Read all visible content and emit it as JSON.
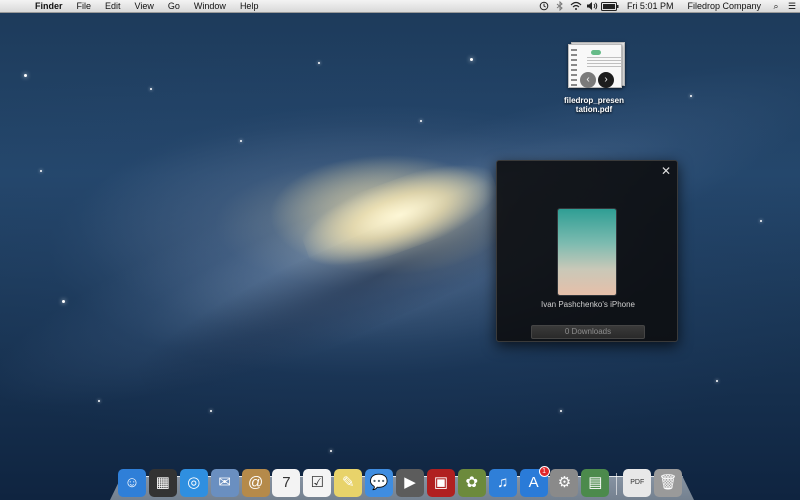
{
  "menubar": {
    "apple_glyph": "",
    "app_name": "Finder",
    "menus": [
      "File",
      "Edit",
      "View",
      "Go",
      "Window",
      "Help"
    ],
    "status_icons": [
      "time-machine-icon",
      "bluetooth-icon",
      "wifi-icon",
      "volume-icon",
      "battery-icon"
    ],
    "clock": "Fri 5:01 PM",
    "user": "Filedrop Company",
    "search_glyph": "⌕",
    "notifications_glyph": "☰"
  },
  "desktop_file": {
    "name": "filedrop_presentation.pdf",
    "label_line1": "filedrop_presen",
    "label_line2": "tation.pdf"
  },
  "popup": {
    "close_glyph": "✕",
    "device_name": "Ivan Pashchenko's iPhone",
    "downloads_label": "0 Downloads"
  },
  "dock": {
    "items": [
      {
        "name": "finder",
        "glyph": "☺",
        "color": "#2f7fd8"
      },
      {
        "name": "launchpad",
        "glyph": "▦",
        "color": "#333333"
      },
      {
        "name": "safari",
        "glyph": "◎",
        "color": "#2f8fe0"
      },
      {
        "name": "mail",
        "glyph": "✉",
        "color": "#6a8fc0"
      },
      {
        "name": "contacts",
        "glyph": "@",
        "color": "#b58a4a"
      },
      {
        "name": "calendar",
        "glyph": "7",
        "color": "#f3f3f3"
      },
      {
        "name": "reminders",
        "glyph": "☑",
        "color": "#f4f4f4"
      },
      {
        "name": "notes",
        "glyph": "✎",
        "color": "#e8d36a"
      },
      {
        "name": "messages",
        "glyph": "💬",
        "color": "#3f8de0"
      },
      {
        "name": "facetime",
        "glyph": "▶",
        "color": "#5c5c5c"
      },
      {
        "name": "photo-booth",
        "glyph": "▣",
        "color": "#b02020"
      },
      {
        "name": "iphoto",
        "glyph": "✿",
        "color": "#6c8a3c"
      },
      {
        "name": "itunes",
        "glyph": "♫",
        "color": "#2f7fd8"
      },
      {
        "name": "app-store",
        "glyph": "A",
        "color": "#2a7bd8",
        "badge": "1"
      },
      {
        "name": "system-preferences",
        "glyph": "⚙",
        "color": "#8a8a8a"
      },
      {
        "name": "filedrop",
        "glyph": "▤",
        "color": "#4c8a4c"
      }
    ],
    "trash_items": [
      {
        "name": "pdf-document",
        "glyph": "PDF",
        "color": "#e8e8e8"
      },
      {
        "name": "trash",
        "glyph": "🗑",
        "color": "#9a9a9a"
      }
    ]
  }
}
